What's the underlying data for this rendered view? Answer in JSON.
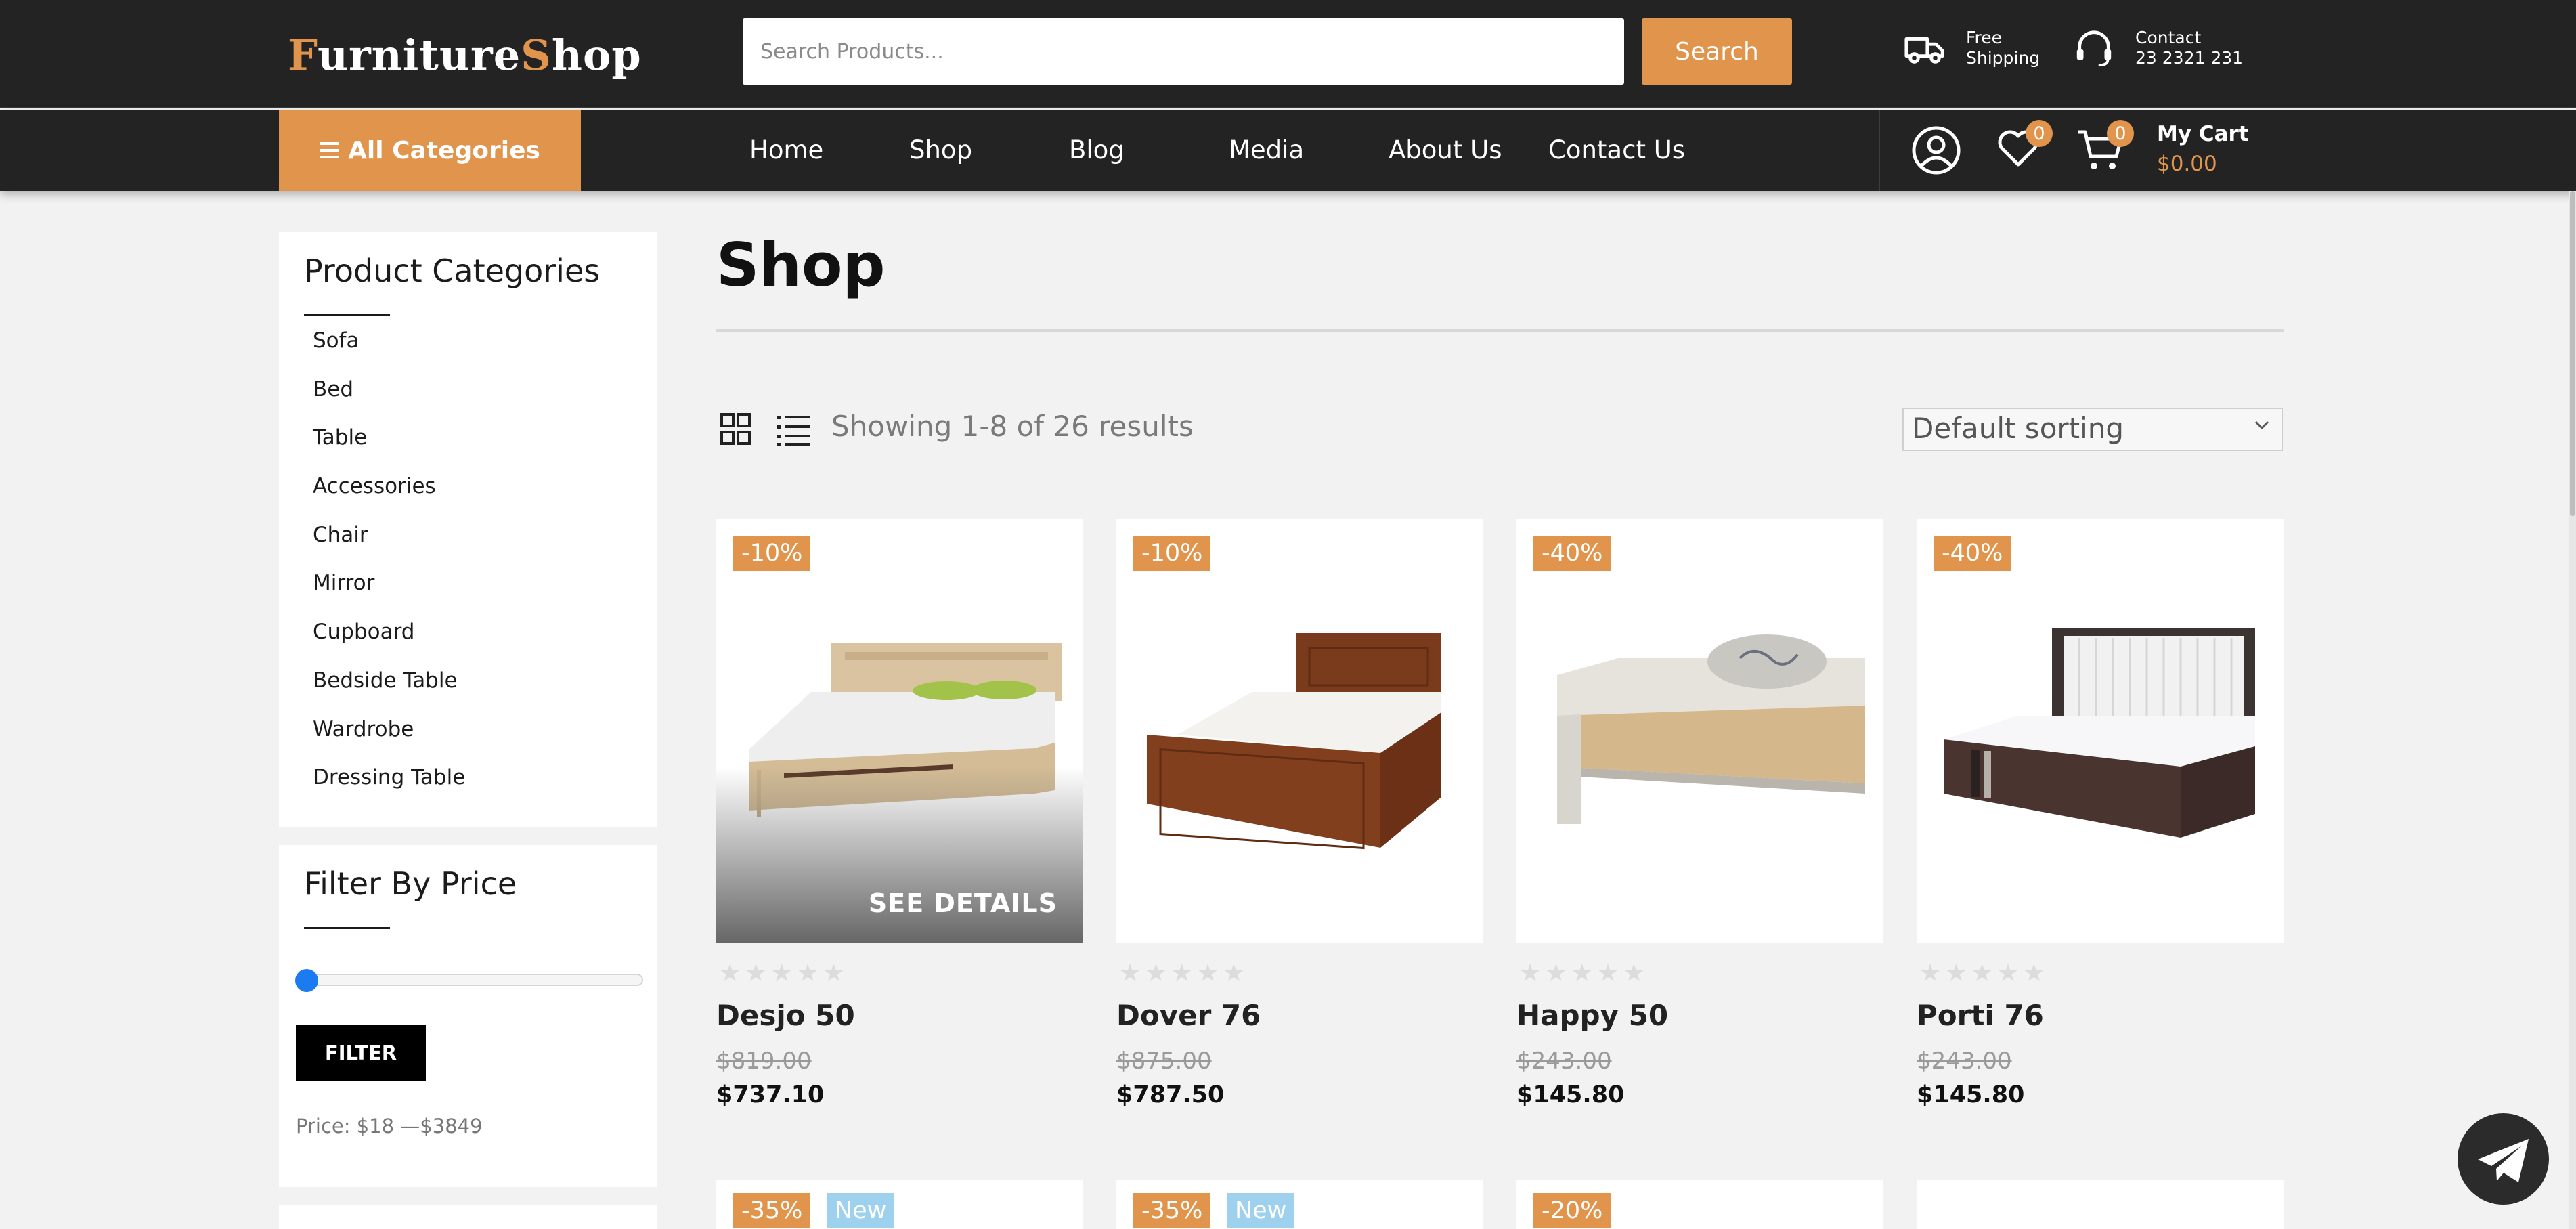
{
  "header": {
    "logo": {
      "first_letter": "F",
      "part1": "urniture",
      "second_letter": "S",
      "part2": "hop"
    },
    "search": {
      "placeholder": "Search Products...",
      "button": "Search"
    },
    "shipping": {
      "line1": "Free",
      "line2": "Shipping",
      "icon": "truck-icon"
    },
    "contact": {
      "line1": "Contact",
      "line2": "23 2321 231",
      "icon": "headset-icon"
    }
  },
  "nav": {
    "all_categories": "All Categories",
    "items": [
      "Home",
      "Shop",
      "Blog",
      "Media",
      "About Us",
      "Contact Us"
    ],
    "wishlist_count": "0",
    "cart_count": "0",
    "cart_title": "My Cart",
    "cart_total": "$0.00"
  },
  "sidebar": {
    "categories_title": "Product Categories",
    "categories": [
      "Sofa",
      "Bed",
      "Table",
      "Accessories",
      "Chair",
      "Mirror",
      "Cupboard",
      "Bedside Table",
      "Wardrobe",
      "Dressing Table"
    ],
    "price_title": "Filter By Price",
    "filter_button": "FILTER",
    "price_range": "Price: $18 —$3849",
    "slider_position": 0
  },
  "main": {
    "title": "Shop",
    "result_count": "Showing 1-8 of 26 results",
    "sort": "Default sorting",
    "products": [
      {
        "discount": "-10%",
        "name": "Desjo 50",
        "old_price": "$819.00",
        "price": "$737.10",
        "hover_label": "SEE DETAILS",
        "rating": 0
      },
      {
        "discount": "-10%",
        "name": "Dover 76",
        "old_price": "$875.00",
        "price": "$787.50",
        "rating": 0
      },
      {
        "discount": "-40%",
        "name": "Happy 50",
        "old_price": "$243.00",
        "price": "$145.80",
        "rating": 0
      },
      {
        "discount": "-40%",
        "name": "Porti 76",
        "old_price": "$243.00",
        "price": "$145.80",
        "rating": 0
      }
    ],
    "row2_tags": [
      {
        "discount": "-35%",
        "new": "New"
      },
      {
        "discount": "-35%",
        "new": "New"
      },
      {
        "discount": "-20%"
      },
      {}
    ]
  },
  "colors": {
    "accent": "#e0944c",
    "dark": "#232323",
    "new_badge": "#9dd1ee",
    "slider": "#1a7cf0"
  }
}
